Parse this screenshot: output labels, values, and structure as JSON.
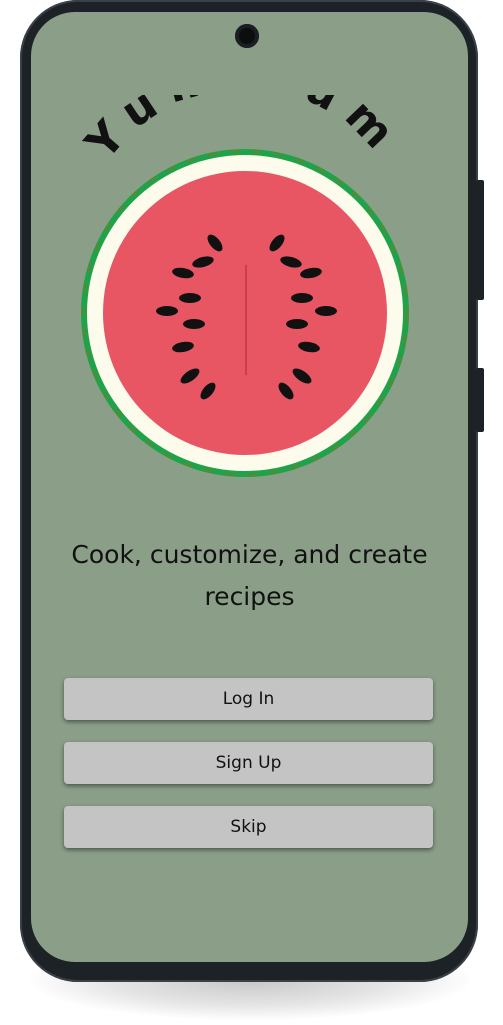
{
  "app": {
    "logo_text": "Yum Yum",
    "tagline": "Cook, customize, and create recipes"
  },
  "actions": {
    "login_label": "Log In",
    "signup_label": "Sign Up",
    "skip_label": "Skip"
  },
  "colors": {
    "screen_background": "#8a9e88",
    "button_background": "#c4c4c4",
    "watermelon_flesh": "#e85664",
    "watermelon_rind": "#1fa34a",
    "watermelon_pith": "#fdfbec",
    "seed": "#111111"
  },
  "icons": {
    "logo": "watermelon-icon",
    "camera": "front-camera"
  }
}
